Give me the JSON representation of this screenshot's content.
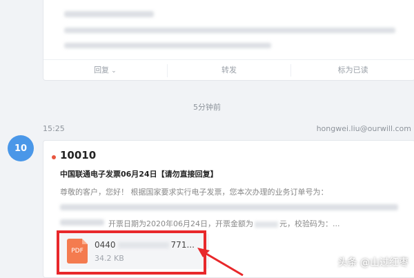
{
  "previous_email": {
    "actions": [
      {
        "label": "回复",
        "has_dropdown": true
      },
      {
        "label": "转发",
        "has_dropdown": false
      },
      {
        "label": "标为已读",
        "has_dropdown": false
      }
    ]
  },
  "time_separator": "5分钟前",
  "message": {
    "time": "15:25",
    "account_email": "hongwei.liu@ourwill.com",
    "avatar_text": "10",
    "sender": "10010",
    "unread": true,
    "subject": "中国联通电子发票06月24日【请勿直接回复】",
    "preview_line1": "尊敬的客户，您好！ 根据国家要求实行电子发票，您本次办理的业务订单号为：",
    "preview_line2_a": "开票日期为2020年06月24日，开票金额为",
    "preview_line2_b": "元，校验码为：..."
  },
  "attachment": {
    "name_start": "0440",
    "name_end": "771...",
    "size": "34.2 KB",
    "icon_label": "PDF"
  },
  "annotation": {
    "color": "#e8282b"
  },
  "watermark": "头条 @山过红枣"
}
